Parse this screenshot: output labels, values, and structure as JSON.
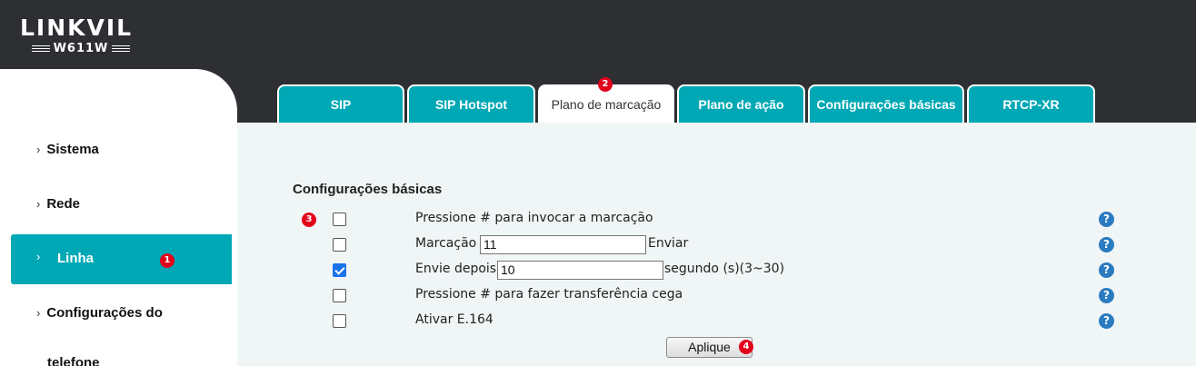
{
  "header": {
    "brand": "LINKVIL",
    "model": "W611W"
  },
  "sidebar": {
    "items": [
      {
        "label": "Sistema"
      },
      {
        "label": "Rede"
      },
      {
        "label": "Linha",
        "badge": "1"
      },
      {
        "label": "Configurações do"
      },
      {
        "label": "telefone"
      }
    ]
  },
  "tabs": [
    {
      "label": "SIP"
    },
    {
      "label": "SIP Hotspot"
    },
    {
      "label": "Plano de marcação",
      "badge": "2"
    },
    {
      "label": "Plano de ação"
    },
    {
      "label": "Configurações básicas"
    },
    {
      "label": "RTCP-XR"
    }
  ],
  "section": {
    "title": "Configurações básicas",
    "badge": "3"
  },
  "rows": [
    {
      "label": "Pressione # para invocar a marcação",
      "checked": false
    },
    {
      "label": "Marcação",
      "value": "11",
      "suffix": "Enviar",
      "checked": false
    },
    {
      "label": "Envie depois",
      "value": "10",
      "suffix": "segundo (s)(3~30)",
      "checked": true
    },
    {
      "label": "Pressione # para fazer transferência cega",
      "checked": false
    },
    {
      "label": "Ativar E.164",
      "checked": false
    }
  ],
  "help_symbol": "?",
  "apply": {
    "label": "Aplique",
    "badge": "4"
  },
  "colors": {
    "accent": "#00a8b5",
    "header_bg": "#2d2f33",
    "badge": "#e3001b"
  }
}
